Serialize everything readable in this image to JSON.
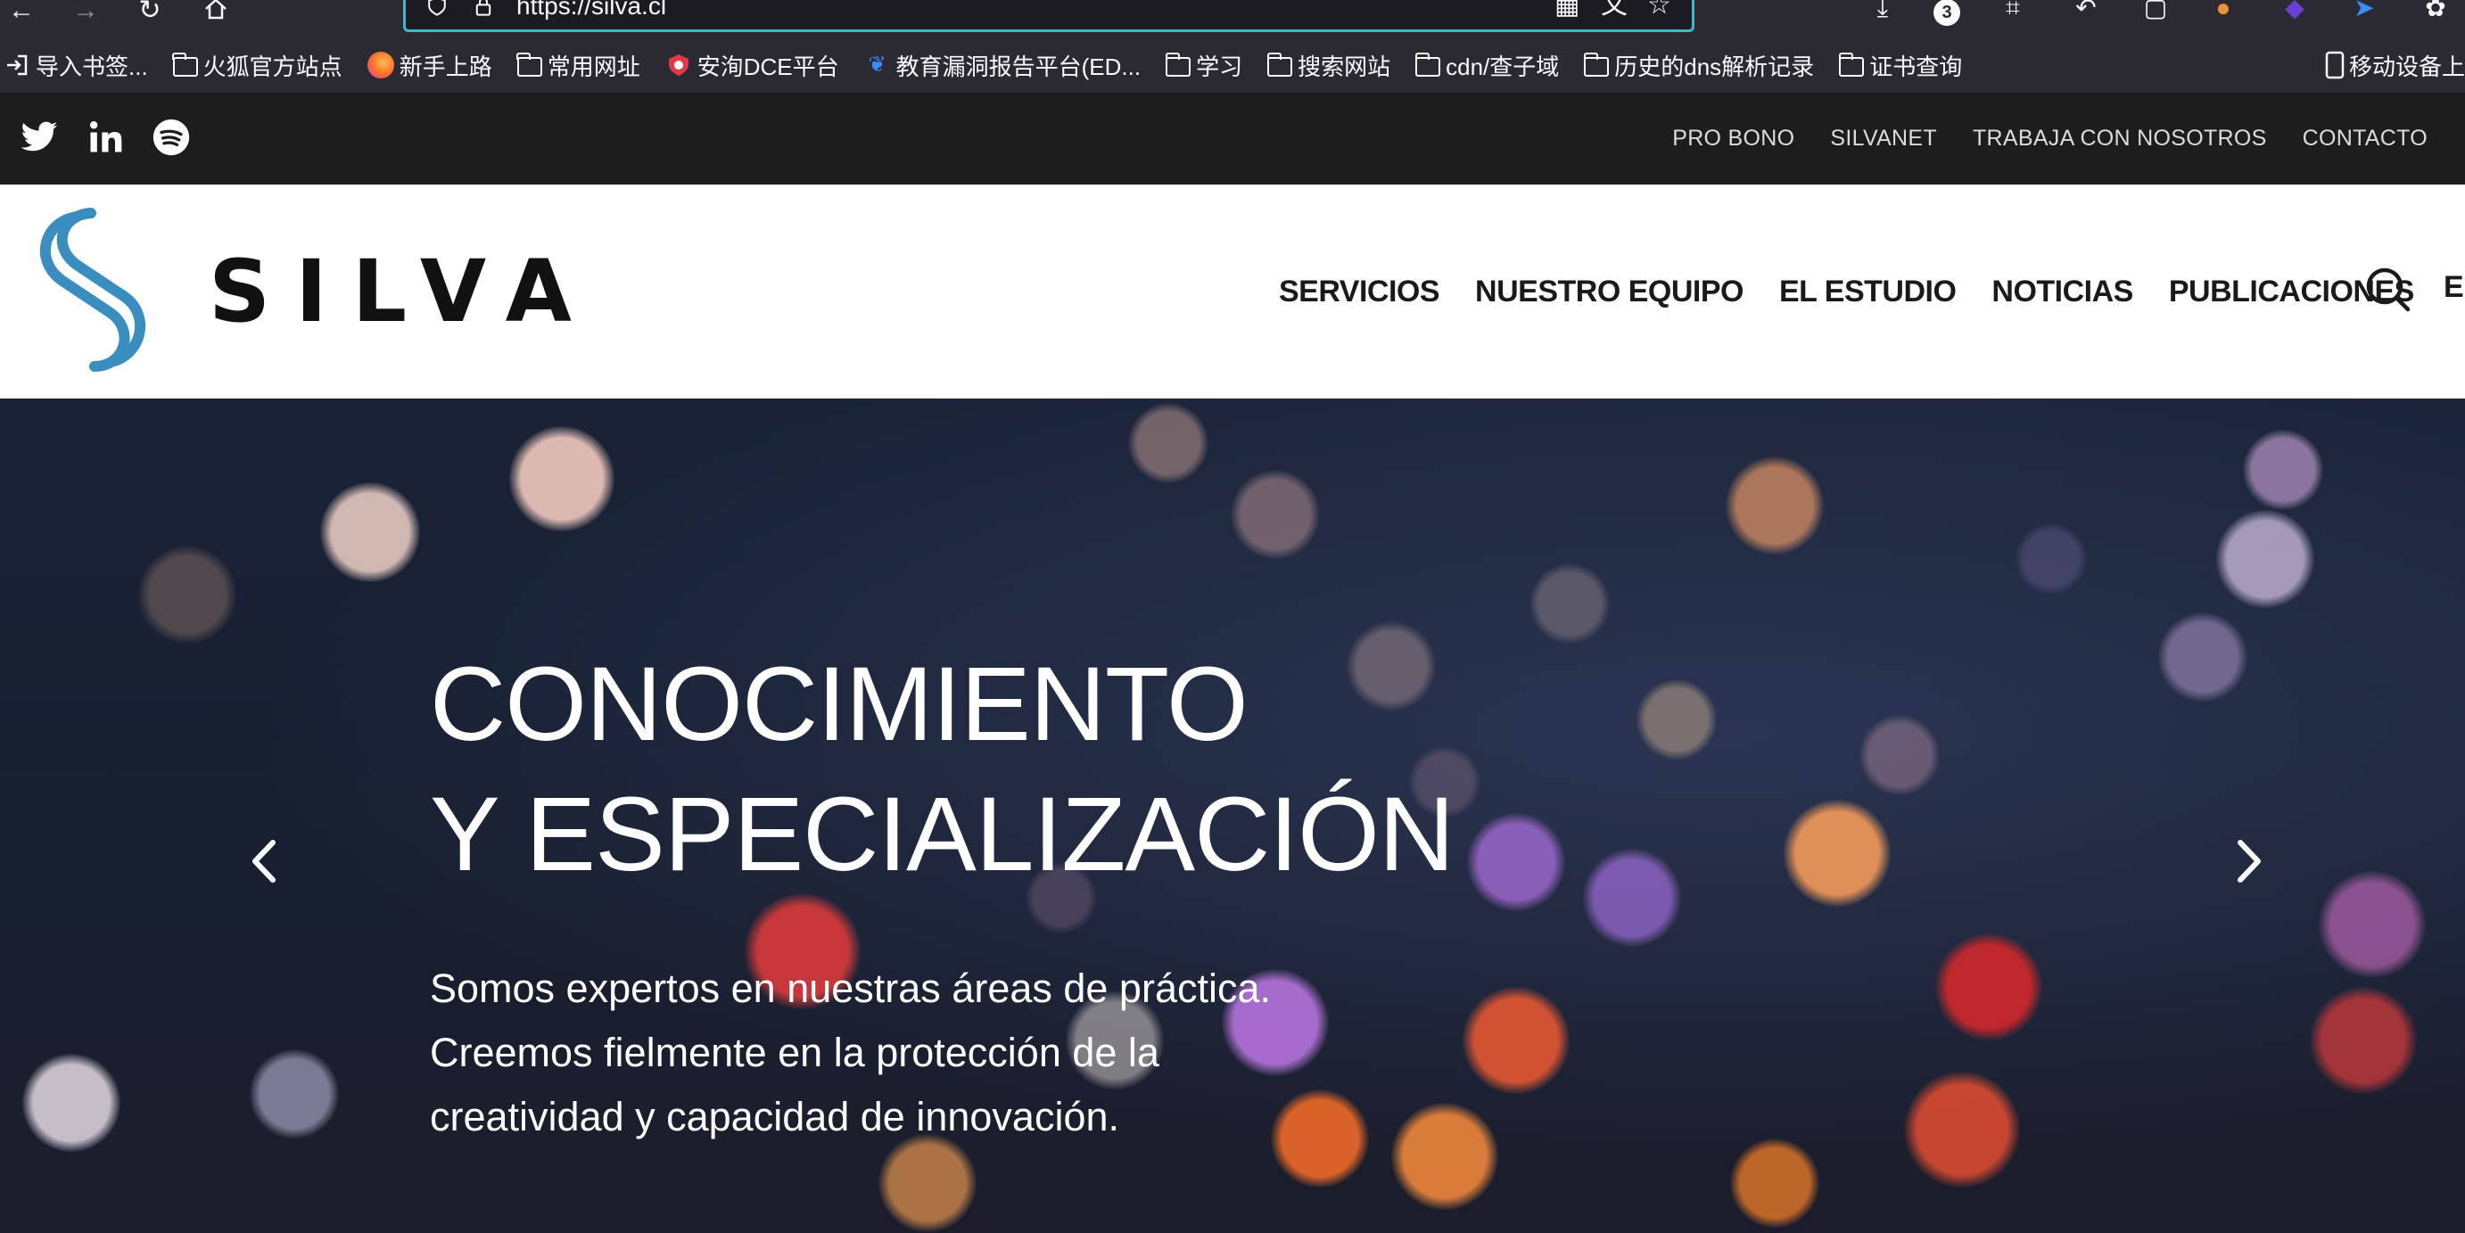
{
  "browser": {
    "url": "https://silva.cl",
    "download_badge": "3"
  },
  "bookmarks": {
    "items": [
      {
        "label": "导入书签...",
        "icon": "import-icon"
      },
      {
        "label": "火狐官方站点",
        "icon": "folder-icon"
      },
      {
        "label": "新手上路",
        "icon": "firefox-icon"
      },
      {
        "label": "常用网址",
        "icon": "folder-icon"
      },
      {
        "label": "安洵DCE平台",
        "icon": "shield-icon"
      },
      {
        "label": "教育漏洞报告平台(ED...",
        "icon": "bird-icon"
      },
      {
        "label": "学习",
        "icon": "folder-icon"
      },
      {
        "label": "搜索网站",
        "icon": "folder-icon"
      },
      {
        "label": "cdn/查子域",
        "icon": "folder-icon"
      },
      {
        "label": "历史的dns解析记录",
        "icon": "folder-icon"
      },
      {
        "label": "证书查询",
        "icon": "folder-icon"
      }
    ],
    "mobile": "移动设备上"
  },
  "topbar": {
    "links": [
      "PRO BONO",
      "SILVANET",
      "TRABAJA CON NOSOTROS",
      "CONTACTO"
    ]
  },
  "header": {
    "logo_text": "SILVA",
    "nav": [
      "SERVICIOS",
      "NUESTRO EQUIPO",
      "EL ESTUDIO",
      "NOTICIAS",
      "PUBLICACIONES"
    ],
    "lang": "E"
  },
  "hero": {
    "title_line1": "CONOCIMIENTO",
    "title_line2": "Y ESPECIALIZACIÓN",
    "text": "Somos expertos en nuestras áreas de práctica. Creemos fielmente en la protección de la creatividad y capacidad de innovación."
  },
  "colors": {
    "brand_blue": "#3a8dbf",
    "topbar_bg": "#1d1d1d",
    "browser_bg": "#2b2a33",
    "url_focus": "#3fb8c9"
  }
}
